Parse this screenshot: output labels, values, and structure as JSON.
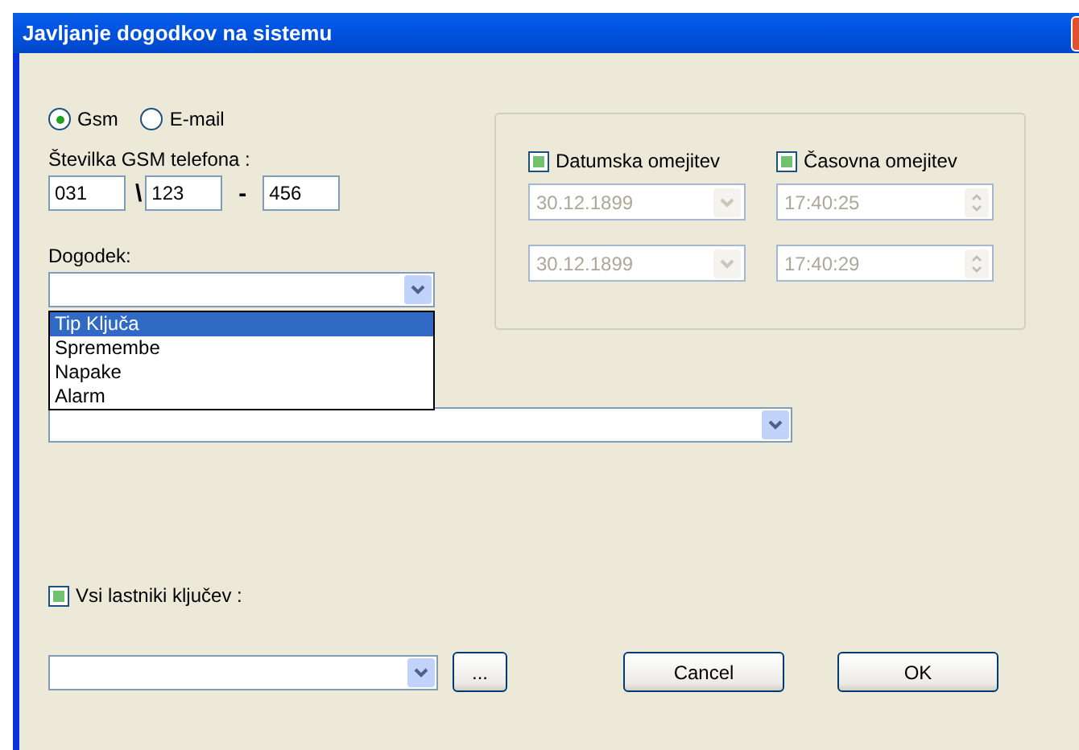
{
  "window": {
    "title": "Javljanje dogodkov na sistemu"
  },
  "notify_via": [
    {
      "label": "Gsm",
      "selected": true
    },
    {
      "label": "E-mail",
      "selected": false
    }
  ],
  "phone": {
    "label": "Številka GSM telefona :",
    "parts": [
      "031",
      "123",
      "456"
    ],
    "separators": [
      "\\",
      "-"
    ]
  },
  "event": {
    "label": "Dogodek:",
    "expanded": true,
    "options": [
      {
        "label": "Tip Ključa",
        "selected": true
      },
      {
        "label": "Spremembe",
        "selected": false
      },
      {
        "label": "Napake",
        "selected": false
      },
      {
        "label": "Alarm",
        "selected": false
      }
    ]
  },
  "limits": [
    {
      "kind": "date",
      "label": "Datumska omejitev",
      "checked": true,
      "disabled": true,
      "values": [
        "30.12.1899",
        "30.12.1899"
      ]
    },
    {
      "kind": "time",
      "label": "Časovna omejitev",
      "checked": true,
      "disabled": true,
      "values": [
        "17:40:25",
        "17:40:29"
      ]
    }
  ],
  "all_owners": {
    "label": "Vsi lastniki ključev :",
    "checked": true
  },
  "buttons": [
    {
      "kind": "browse",
      "label": "..."
    },
    {
      "kind": "cancel",
      "label": "Cancel"
    },
    {
      "kind": "ok",
      "label": "OK"
    }
  ]
}
